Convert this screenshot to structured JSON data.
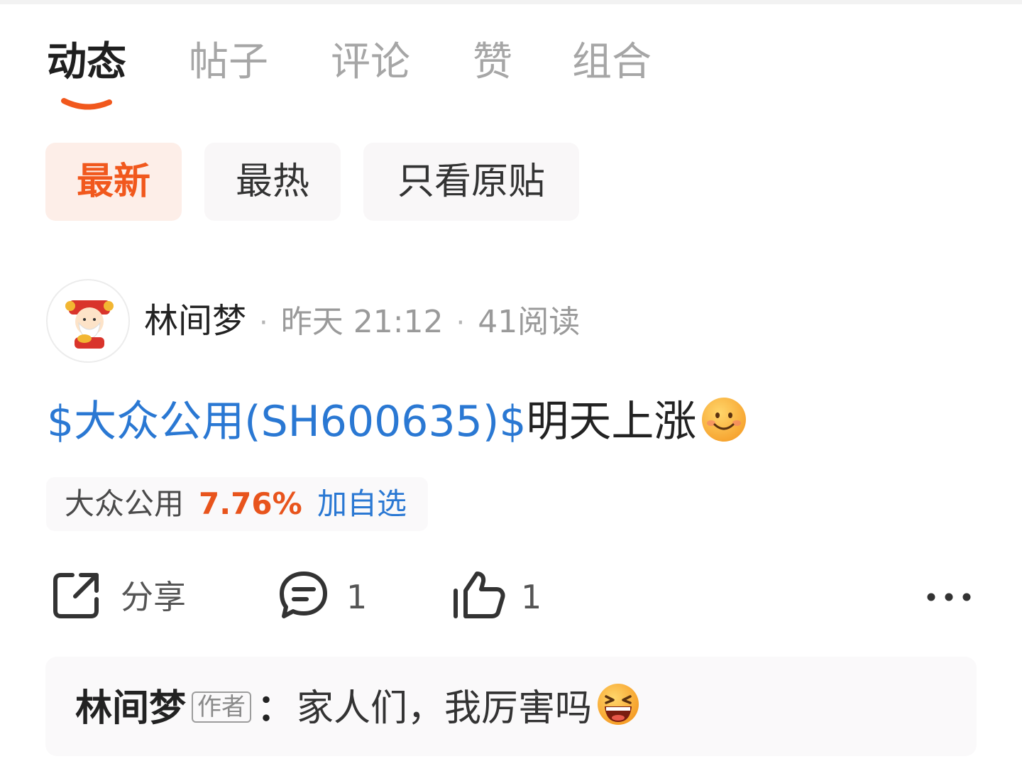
{
  "tabs": [
    {
      "label": "动态",
      "active": true
    },
    {
      "label": "帖子",
      "active": false
    },
    {
      "label": "评论",
      "active": false
    },
    {
      "label": "赞",
      "active": false
    },
    {
      "label": "组合",
      "active": false
    }
  ],
  "filters": [
    {
      "label": "最新",
      "active": true
    },
    {
      "label": "最热",
      "active": false
    },
    {
      "label": "只看原贴",
      "active": false
    }
  ],
  "post": {
    "author": "林间梦",
    "time": "昨天 21:12",
    "reads": "41阅读",
    "stock_link": "$大众公用(SH600635)$",
    "text": "明天上涨",
    "emoji": "smile-emoji"
  },
  "stock_card": {
    "name": "大众公用",
    "change": "7.76%",
    "action": "加自选"
  },
  "actions": {
    "share_label": "分享",
    "comment_count": "1",
    "like_count": "1"
  },
  "comment": {
    "author": "林间梦",
    "tag": "作者",
    "colon": "：",
    "text": "家人们，我厉害吗",
    "emoji": "laugh-emoji"
  },
  "colors": {
    "accent": "#f1581d",
    "link": "#2a78d3",
    "up": "#e8541c"
  }
}
